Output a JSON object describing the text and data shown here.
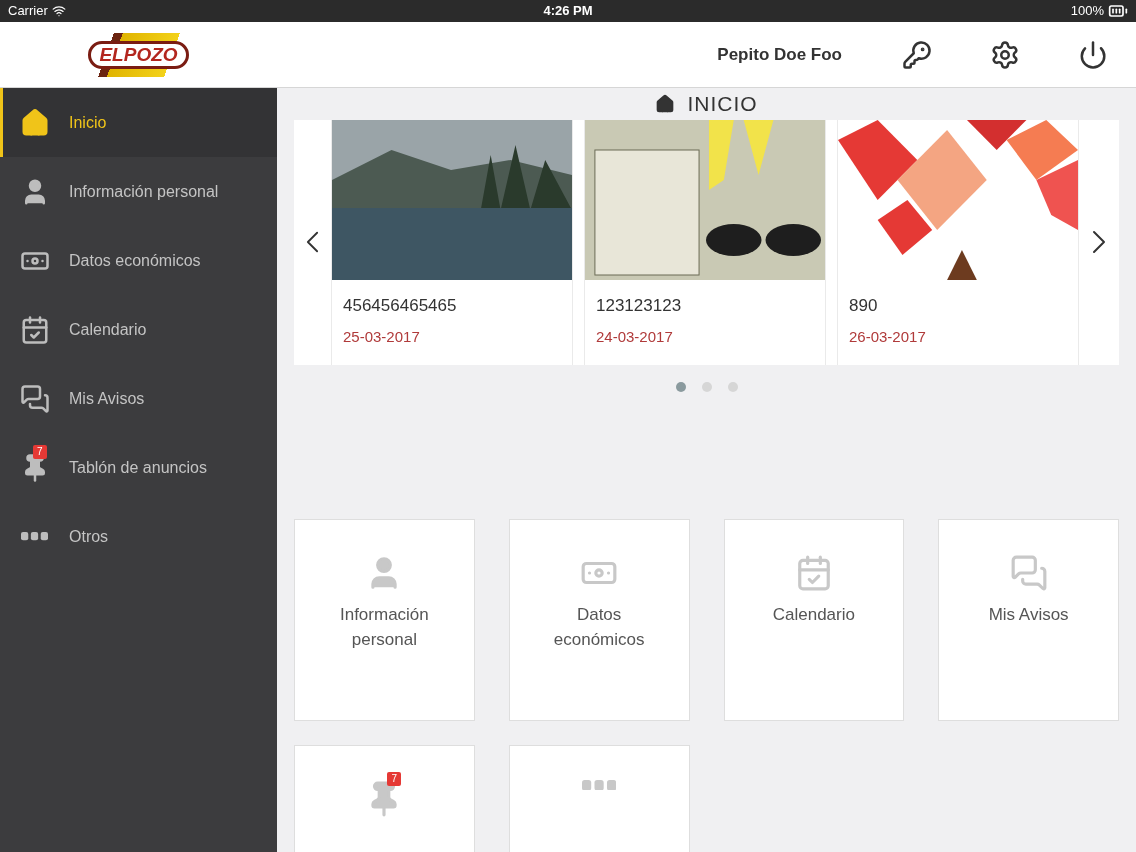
{
  "status_bar": {
    "carrier": "Carrier",
    "time": "4:26 PM",
    "battery": "100%"
  },
  "header": {
    "logo": "ELPOZO",
    "user": "Pepito Doe Foo"
  },
  "sidebar": {
    "items": [
      {
        "kind": "home",
        "label": "Inicio",
        "selected": true
      },
      {
        "kind": "user",
        "label": "Información personal",
        "selected": false
      },
      {
        "kind": "money",
        "label": "Datos económicos",
        "selected": false
      },
      {
        "kind": "calendar",
        "label": "Calendario",
        "selected": false
      },
      {
        "kind": "chat",
        "label": "Mis Avisos",
        "selected": false
      },
      {
        "kind": "pin",
        "label": "Tablón de anuncios",
        "selected": false,
        "badge": "7"
      },
      {
        "kind": "more",
        "label": "Otros",
        "selected": false
      }
    ]
  },
  "page_title": "INICIO",
  "carousel": {
    "cards": [
      {
        "kind": "lake",
        "title": "456456465465",
        "date": "25-03-2017"
      },
      {
        "kind": "infographic",
        "title": "123123123",
        "date": "24-03-2017"
      },
      {
        "kind": "abstract",
        "title": "890",
        "date": "26-03-2017"
      }
    ],
    "dots": [
      {
        "selected": true
      },
      {
        "selected": false
      },
      {
        "selected": false
      }
    ]
  },
  "tiles": [
    {
      "kind": "user",
      "label": "Información personal"
    },
    {
      "kind": "money",
      "label": "Datos económicos"
    },
    {
      "kind": "calendar",
      "label": "Calendario"
    },
    {
      "kind": "chat",
      "label": "Mis Avisos"
    },
    {
      "kind": "pin",
      "badge": "7"
    },
    {
      "kind": "more"
    }
  ]
}
